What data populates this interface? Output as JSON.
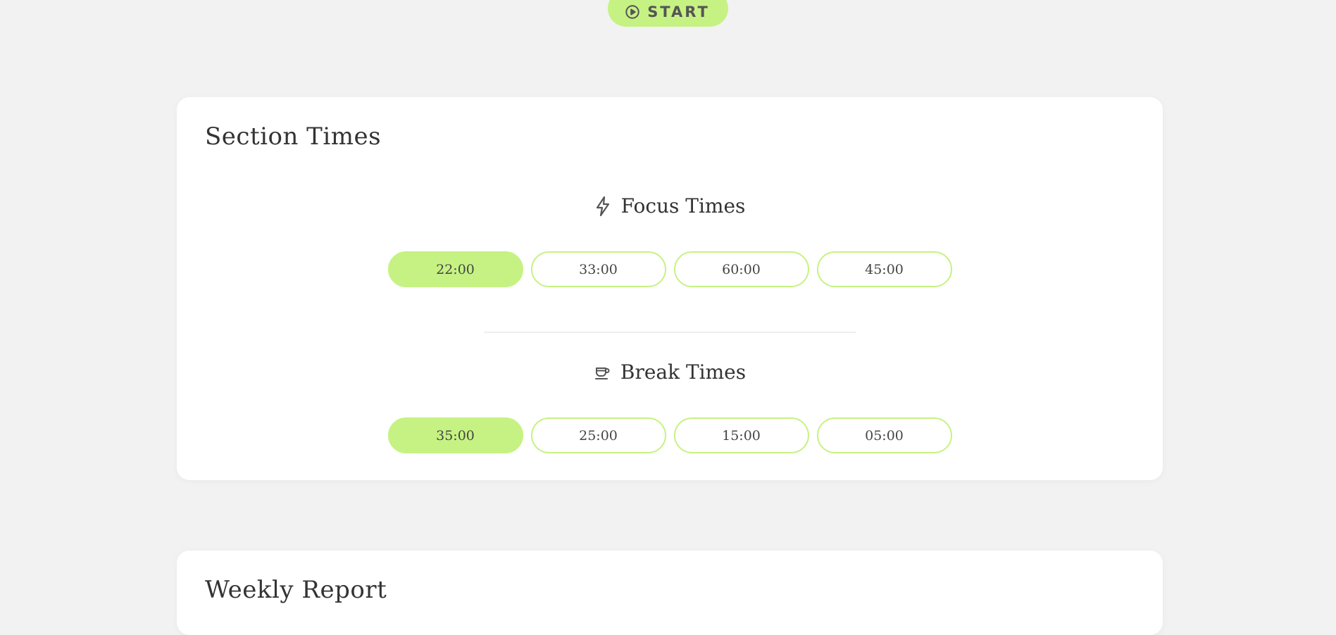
{
  "start_button": {
    "label": "START",
    "icon": "play-circle-icon"
  },
  "colors": {
    "accent": "#c6f283",
    "background": "#f2f2f2",
    "card": "#ffffff"
  },
  "section_times": {
    "title": "Section Times",
    "focus": {
      "heading": "Focus Times",
      "icon": "lightning-bolt-icon",
      "options": [
        {
          "label": "22:00",
          "selected": true
        },
        {
          "label": "33:00",
          "selected": false
        },
        {
          "label": "60:00",
          "selected": false
        },
        {
          "label": "45:00",
          "selected": false
        }
      ]
    },
    "break": {
      "heading": "Break Times",
      "icon": "coffee-cup-icon",
      "options": [
        {
          "label": "35:00",
          "selected": true
        },
        {
          "label": "25:00",
          "selected": false
        },
        {
          "label": "15:00",
          "selected": false
        },
        {
          "label": "05:00",
          "selected": false
        }
      ]
    }
  },
  "weekly_report": {
    "title": "Weekly Report"
  }
}
